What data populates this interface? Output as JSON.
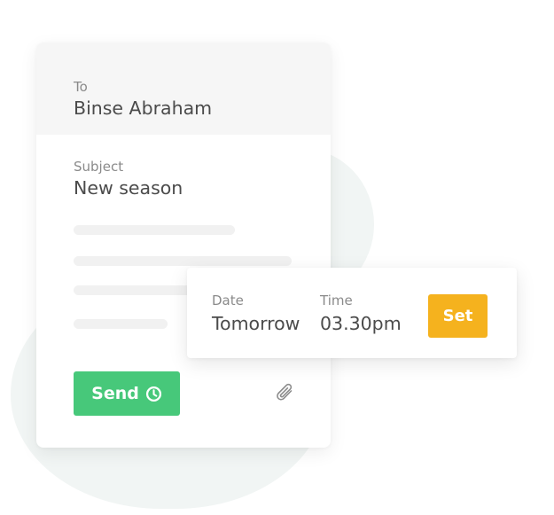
{
  "email": {
    "to_label": "To",
    "to_value": "Binse Abraham",
    "subject_label": "Subject",
    "subject_value": "New season",
    "send_label": "Send",
    "send_icon": "clock-icon",
    "attach_icon": "paperclip-icon"
  },
  "schedule": {
    "date_label": "Date",
    "date_value": "Tomorrow",
    "time_label": "Time",
    "time_value": "03.30pm",
    "set_label": "Set"
  },
  "colors": {
    "send_button": "#47c87a",
    "set_button": "#f5b21e",
    "header_background": "#f6f6f6",
    "background_blob": "#f1f5f4"
  }
}
